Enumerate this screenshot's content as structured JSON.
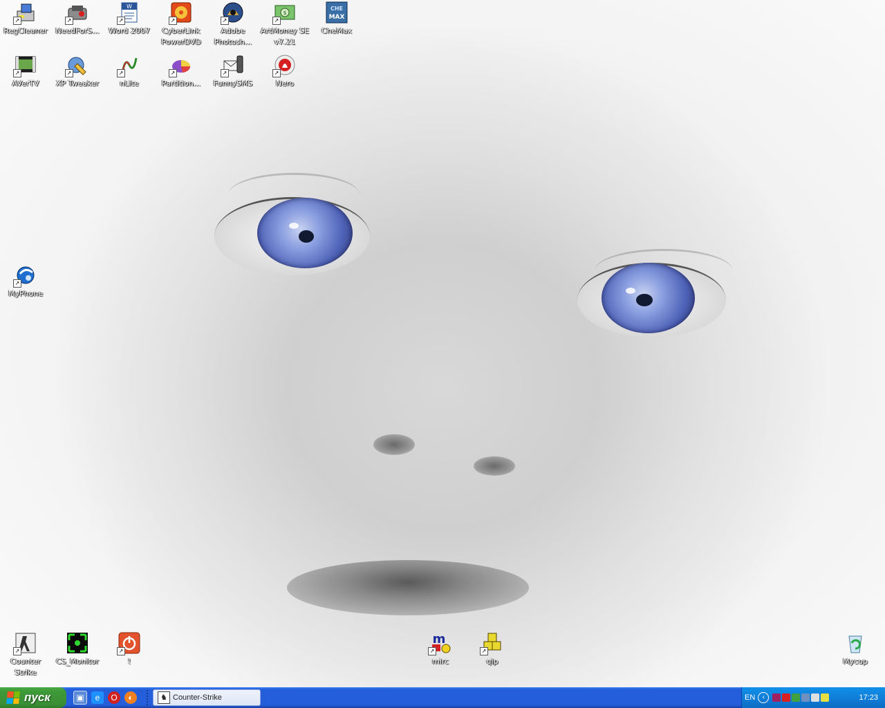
{
  "desktop": {
    "icons": [
      {
        "label": "RegCleaner",
        "icon": "regcleaner-icon"
      },
      {
        "label": "NeedForS...",
        "icon": "need-for-speed-icon"
      },
      {
        "label": "Word 2007",
        "icon": "word-icon"
      },
      {
        "label": "CyberLink PowerDVD",
        "icon": "powerdvd-icon"
      },
      {
        "label": "Adobe Photosh...",
        "icon": "photoshop-icon"
      },
      {
        "label": "ArtMoney SE v7.21",
        "icon": "artmoney-icon"
      },
      {
        "label": "CheMax",
        "icon": "chemax-icon"
      },
      {
        "label": "AVerTV",
        "icon": "avertv-icon"
      },
      {
        "label": "XP Tweaker",
        "icon": "xp-tweaker-icon"
      },
      {
        "label": "nLite",
        "icon": "nlite-icon"
      },
      {
        "label": "Partition...",
        "icon": "partition-icon"
      },
      {
        "label": "FunnySMS",
        "icon": "funnysms-icon"
      },
      {
        "label": "Nero",
        "icon": "nero-icon"
      },
      {
        "label": "MyPhone",
        "icon": "myphone-icon"
      },
      {
        "label": "Counter Strike",
        "icon": "counter-strike-icon"
      },
      {
        "label": "CS_Monitor",
        "icon": "cs-monitor-icon"
      },
      {
        "label": "!",
        "icon": "power-icon"
      },
      {
        "label": "mirc",
        "icon": "mirc-icon"
      },
      {
        "label": "qip",
        "icon": "qip-icon"
      },
      {
        "label": "Мусор",
        "icon": "recycle-bin-icon"
      }
    ]
  },
  "taskbar": {
    "start_label": "пуск",
    "task_button_label": "Counter-Strike",
    "language": "EN",
    "clock": "17:23"
  }
}
